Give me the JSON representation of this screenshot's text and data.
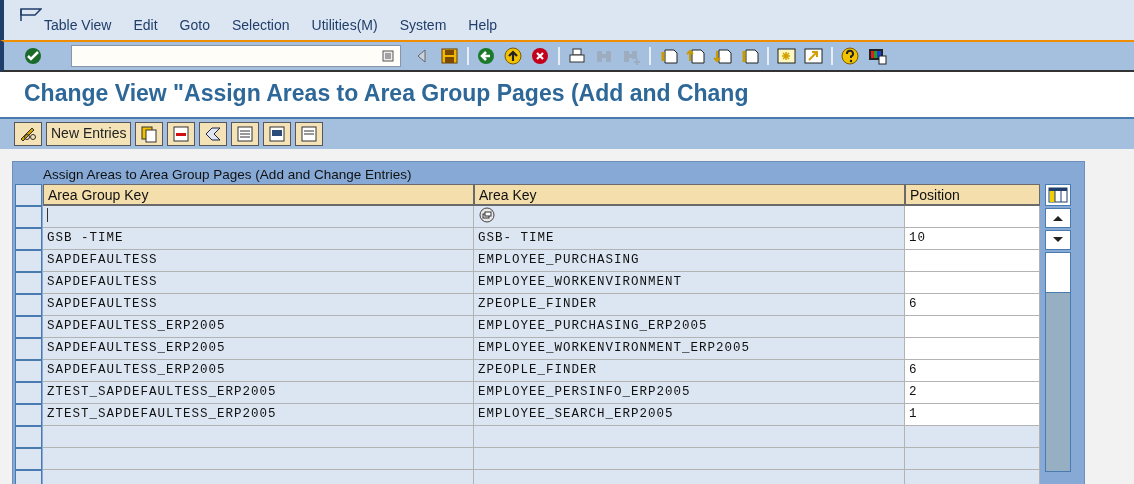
{
  "menu": [
    "Table View",
    "Edit",
    "Goto",
    "Selection",
    "Utilities(M)",
    "System",
    "Help"
  ],
  "toolbar": [
    {
      "kind": "enter",
      "disabled": false
    },
    {
      "kind": "command"
    },
    {
      "kind": "triangle",
      "disabled": false
    },
    {
      "kind": "save",
      "disabled": false
    },
    {
      "kind": "sep"
    },
    {
      "kind": "back",
      "disabled": false
    },
    {
      "kind": "exit",
      "disabled": false
    },
    {
      "kind": "cancel",
      "disabled": false
    },
    {
      "kind": "sep"
    },
    {
      "kind": "print",
      "disabled": false
    },
    {
      "kind": "find",
      "disabled": true
    },
    {
      "kind": "findnext",
      "disabled": true
    },
    {
      "kind": "sep"
    },
    {
      "kind": "first",
      "disabled": false
    },
    {
      "kind": "prev",
      "disabled": false
    },
    {
      "kind": "next",
      "disabled": false
    },
    {
      "kind": "last",
      "disabled": false
    },
    {
      "kind": "sep"
    },
    {
      "kind": "session",
      "disabled": false
    },
    {
      "kind": "shortcut",
      "disabled": false
    },
    {
      "kind": "sep"
    },
    {
      "kind": "help",
      "disabled": false
    },
    {
      "kind": "layout",
      "disabled": false
    }
  ],
  "title": "Change View \"Assign Areas to Area Group Pages (Add and Chang",
  "app_toolbar": [
    {
      "kind": "display"
    },
    {
      "kind": "text",
      "label": "New Entries"
    },
    {
      "kind": "copy"
    },
    {
      "kind": "delete"
    },
    {
      "kind": "undo"
    },
    {
      "kind": "selectall"
    },
    {
      "kind": "selectblock"
    },
    {
      "kind": "deselect"
    }
  ],
  "table": {
    "title": "Assign Areas to Area Group Pages (Add and Change Entries)",
    "columns": [
      "Area Group Key",
      "Area Key",
      "Position"
    ],
    "rows": [
      {
        "kind": "input",
        "cells": [
          "",
          "",
          ""
        ]
      },
      {
        "kind": "entry",
        "cells": [
          "GSB -TIME",
          "GSB- TIME",
          "10"
        ]
      },
      {
        "kind": "entry",
        "cells": [
          "SAPDEFAULTESS",
          "EMPLOYEE_PURCHASING",
          ""
        ]
      },
      {
        "kind": "entry",
        "cells": [
          "SAPDEFAULTESS",
          "EMPLOYEE_WORKENVIRONMENT",
          ""
        ]
      },
      {
        "kind": "entry",
        "cells": [
          "SAPDEFAULTESS",
          "ZPEOPLE_FINDER",
          "6"
        ]
      },
      {
        "kind": "entry",
        "cells": [
          "SAPDEFAULTESS_ERP2005",
          "EMPLOYEE_PURCHASING_ERP2005",
          ""
        ]
      },
      {
        "kind": "entry",
        "cells": [
          "SAPDEFAULTESS_ERP2005",
          "EMPLOYEE_WORKENVIRONMENT_ERP2005",
          ""
        ]
      },
      {
        "kind": "entry",
        "cells": [
          "SAPDEFAULTESS_ERP2005",
          "ZPEOPLE_FINDER",
          "6"
        ]
      },
      {
        "kind": "entry",
        "cells": [
          "ZTEST_SAPDEFAULTESS_ERP2005",
          "EMPLOYEE_PERSINFO_ERP2005",
          "2"
        ]
      },
      {
        "kind": "entry",
        "cells": [
          "ZTEST_SAPDEFAULTESS_ERP2005",
          "EMPLOYEE_SEARCH_ERP2005",
          "1"
        ]
      },
      {
        "kind": "empty",
        "cells": [
          "",
          "",
          ""
        ]
      },
      {
        "kind": "empty",
        "cells": [
          "",
          "",
          ""
        ]
      },
      {
        "kind": "empty",
        "cells": [
          "",
          "",
          ""
        ]
      }
    ]
  }
}
